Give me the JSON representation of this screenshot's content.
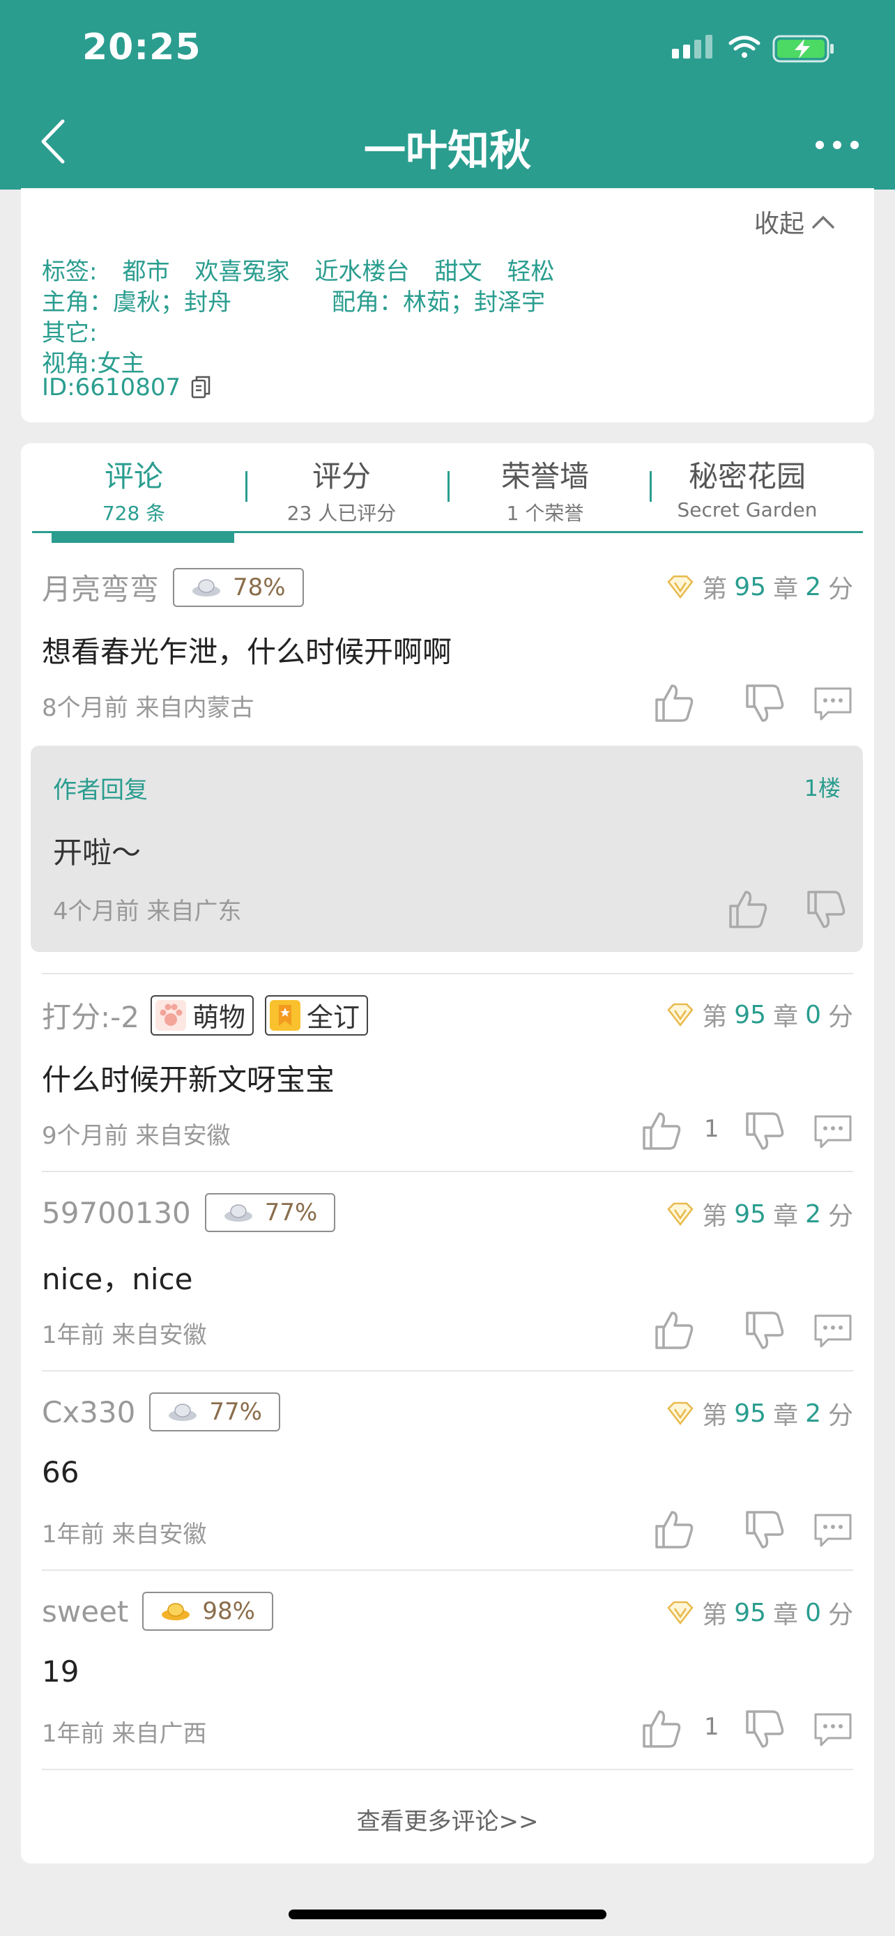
{
  "status_bar": {
    "time": "20:25"
  },
  "nav": {
    "title": "一叶知秋"
  },
  "info": {
    "collapse_label": "收起",
    "tags_label": "标签:",
    "tags": [
      "都市",
      "欢喜冤家",
      "近水楼台",
      "甜文",
      "轻松"
    ],
    "protagonist": "主角：虞秋；封舟",
    "supporting": "配角：林茹；封泽宇",
    "other": "其它:",
    "perspective": "视角:女主",
    "id": "ID:6610807"
  },
  "tabs": [
    {
      "label": "评论",
      "sub": "728 条",
      "active": true
    },
    {
      "label": "评分",
      "sub": "23 人已评分",
      "active": false
    },
    {
      "label": "荣誉墙",
      "sub": "1 个荣誉",
      "active": false
    },
    {
      "label": "秘密花园",
      "sub": "Secret Garden",
      "active": false
    }
  ],
  "comments": [
    {
      "user": "月亮弯弯",
      "badge": "78%",
      "badge_icon": "silver-ingot-icon",
      "chapter_prefix": "第",
      "chapter": "95",
      "chapter_unit": "章",
      "score": "2",
      "score_unit": "分",
      "text": "想看春光乍泄，什么时候开啊啊",
      "meta": "8个月前  来自内蒙古",
      "likes": ""
    },
    {
      "user": "打分:-2",
      "tags": [
        "萌物",
        "全订"
      ],
      "chapter_prefix": "第",
      "chapter": "95",
      "chapter_unit": "章",
      "score": "0",
      "score_unit": "分",
      "text": "什么时候开新文呀宝宝",
      "meta": "9个月前  来自安徽",
      "likes": "1"
    },
    {
      "user": "59700130",
      "badge": "77%",
      "badge_icon": "silver-ingot-icon",
      "chapter_prefix": "第",
      "chapter": "95",
      "chapter_unit": "章",
      "score": "2",
      "score_unit": "分",
      "text": "nice，nice",
      "meta": "1年前  来自安徽",
      "likes": ""
    },
    {
      "user": "Cx330",
      "badge": "77%",
      "badge_icon": "silver-ingot-icon",
      "chapter_prefix": "第",
      "chapter": "95",
      "chapter_unit": "章",
      "score": "2",
      "score_unit": "分",
      "text": "66",
      "meta": "1年前  来自安徽",
      "likes": ""
    },
    {
      "user": "sweet",
      "badge": "98%",
      "badge_icon": "gold-ingot-icon",
      "chapter_prefix": "第",
      "chapter": "95",
      "chapter_unit": "章",
      "score": "0",
      "score_unit": "分",
      "text": "19",
      "meta": "1年前  来自广西",
      "likes": "1"
    }
  ],
  "author_reply": {
    "label": "作者回复",
    "floor": "1楼",
    "text": "开啦～",
    "meta": "4个月前  来自广东"
  },
  "more_comments": "查看更多评论>>",
  "colors": {
    "primary": "#2a9d8f",
    "background": "#ededee"
  }
}
